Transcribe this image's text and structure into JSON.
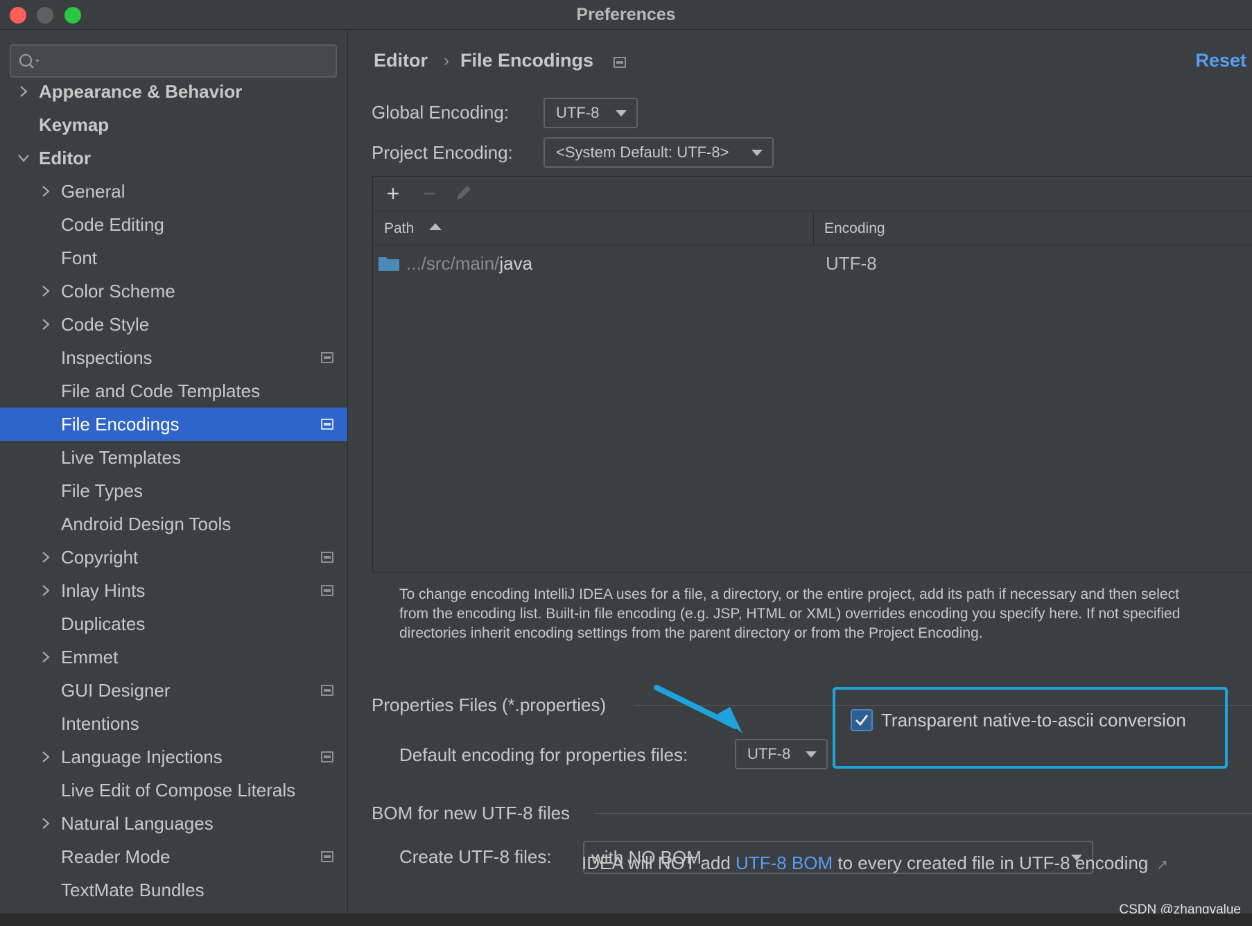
{
  "window": {
    "title": "Preferences"
  },
  "sidebar": {
    "search_placeholder": "",
    "items": [
      {
        "label": "Appearance & Behavior",
        "level": 0,
        "expand": "collapsed",
        "bold": true,
        "scope": false
      },
      {
        "label": "Keymap",
        "level": 0,
        "expand": "none",
        "bold": true,
        "scope": false
      },
      {
        "label": "Editor",
        "level": 0,
        "expand": "expanded",
        "bold": true,
        "scope": false
      },
      {
        "label": "General",
        "level": 1,
        "expand": "collapsed",
        "scope": false
      },
      {
        "label": "Code Editing",
        "level": 1,
        "expand": "none",
        "scope": false
      },
      {
        "label": "Font",
        "level": 1,
        "expand": "none",
        "scope": false
      },
      {
        "label": "Color Scheme",
        "level": 1,
        "expand": "collapsed",
        "scope": false
      },
      {
        "label": "Code Style",
        "level": 1,
        "expand": "collapsed",
        "scope": false
      },
      {
        "label": "Inspections",
        "level": 1,
        "expand": "none",
        "scope": true
      },
      {
        "label": "File and Code Templates",
        "level": 1,
        "expand": "none",
        "scope": false
      },
      {
        "label": "File Encodings",
        "level": 1,
        "expand": "none",
        "scope": true,
        "selected": true
      },
      {
        "label": "Live Templates",
        "level": 1,
        "expand": "none",
        "scope": false
      },
      {
        "label": "File Types",
        "level": 1,
        "expand": "none",
        "scope": false
      },
      {
        "label": "Android Design Tools",
        "level": 1,
        "expand": "none",
        "scope": false
      },
      {
        "label": "Copyright",
        "level": 1,
        "expand": "collapsed",
        "scope": true
      },
      {
        "label": "Inlay Hints",
        "level": 1,
        "expand": "collapsed",
        "scope": true
      },
      {
        "label": "Duplicates",
        "level": 1,
        "expand": "none",
        "scope": false
      },
      {
        "label": "Emmet",
        "level": 1,
        "expand": "collapsed",
        "scope": false
      },
      {
        "label": "GUI Designer",
        "level": 1,
        "expand": "none",
        "scope": true
      },
      {
        "label": "Intentions",
        "level": 1,
        "expand": "none",
        "scope": false
      },
      {
        "label": "Language Injections",
        "level": 1,
        "expand": "collapsed",
        "scope": true
      },
      {
        "label": "Live Edit of Compose Literals",
        "level": 1,
        "expand": "none",
        "scope": false
      },
      {
        "label": "Natural Languages",
        "level": 1,
        "expand": "collapsed",
        "scope": false
      },
      {
        "label": "Reader Mode",
        "level": 1,
        "expand": "none",
        "scope": true
      },
      {
        "label": "TextMate Bundles",
        "level": 1,
        "expand": "none",
        "scope": false
      }
    ]
  },
  "breadcrumb": {
    "parent": "Editor",
    "separator": "›",
    "current": "File Encodings"
  },
  "reset_label": "Reset",
  "global_encoding": {
    "label": "Global Encoding:",
    "value": "UTF-8"
  },
  "project_encoding": {
    "label": "Project Encoding:",
    "value": "<System Default: UTF-8>"
  },
  "toolbar": {
    "add": "+",
    "remove": "−"
  },
  "table": {
    "columns": [
      "Path",
      "Encoding"
    ],
    "rows": [
      {
        "path_prefix": ".../src/main/",
        "path_name": "java",
        "encoding": "UTF-8"
      }
    ]
  },
  "info_lines": [
    "To change encoding IntelliJ IDEA uses for a file, a directory, or the entire project, add its path if necessary and then select",
    "from the encoding list. Built-in file encoding (e.g. JSP, HTML or XML) overrides encoding you specify here. If not specified",
    "directories inherit encoding settings from the parent directory or from the Project Encoding."
  ],
  "properties": {
    "section_title": "Properties Files (*.properties)",
    "default_label": "Default encoding for properties files:",
    "default_value": "UTF-8",
    "transparent_label": "Transparent native-to-ascii conversion",
    "transparent_checked": true
  },
  "bom": {
    "section_title": "BOM for new UTF-8 files",
    "create_label": "Create UTF-8 files:",
    "create_value": "with NO BOM",
    "hint_before": "IDEA will NOT add ",
    "hint_link": "UTF-8 BOM",
    "hint_after": " to every created file in UTF-8 encoding",
    "hint_ext": "↗"
  },
  "watermark": "CSDN @zhangvalue",
  "colors": {
    "accent": "#2f65ca",
    "link": "#589df6",
    "highlight": "#1ea4dc",
    "background": "#3c3f41"
  }
}
